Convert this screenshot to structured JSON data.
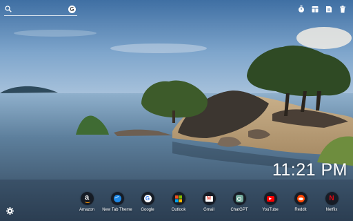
{
  "search": {
    "placeholder": "",
    "engine_icon": "google-icon",
    "engine_glyph": "G"
  },
  "top_icons": [
    "timer-icon",
    "grid-icon",
    "note-icon",
    "trash-icon"
  ],
  "clock": {
    "time": "11:21 PM"
  },
  "apps": [
    {
      "label": "Amazon",
      "icon": "amazon-icon",
      "glyph": "a",
      "color": "#ffffff"
    },
    {
      "label": "New Tab Theme",
      "icon": "new-tab-theme-icon",
      "glyph": "",
      "color": "#1e88e5"
    },
    {
      "label": "Google",
      "icon": "google-icon",
      "glyph": "G",
      "color": "#ffffff"
    },
    {
      "label": "Outlook",
      "icon": "outlook-icon",
      "glyph": "",
      "color": "#f25022"
    },
    {
      "label": "Gmail",
      "icon": "gmail-icon",
      "glyph": "M",
      "color": "#ea4335"
    },
    {
      "label": "ChatGPT",
      "icon": "chatgpt-icon",
      "glyph": "",
      "color": "#74aa9c"
    },
    {
      "label": "YouTube",
      "icon": "youtube-icon",
      "glyph": "▶",
      "color": "#ff0000"
    },
    {
      "label": "Reddit",
      "icon": "reddit-icon",
      "glyph": "",
      "color": "#ff4500"
    },
    {
      "label": "Netflix",
      "icon": "netflix-icon",
      "glyph": "N",
      "color": "#e50914"
    }
  ],
  "settings": {
    "icon": "gear-icon"
  }
}
